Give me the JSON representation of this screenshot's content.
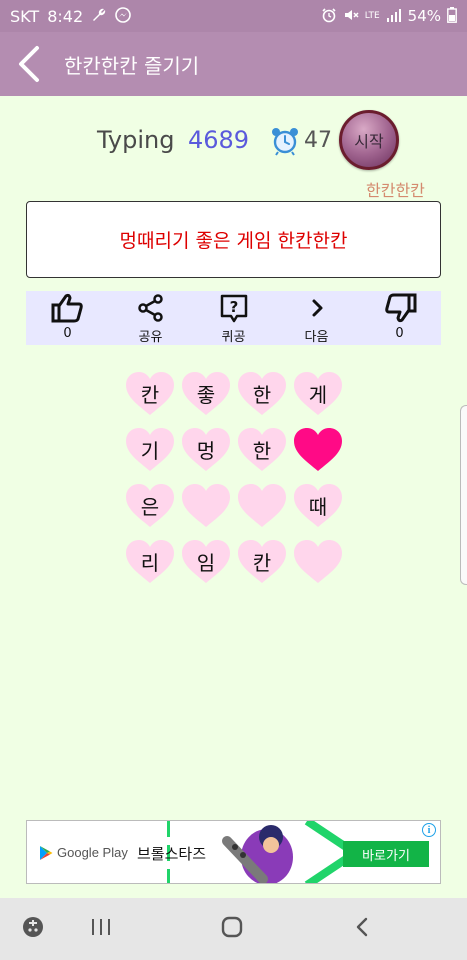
{
  "status_bar": {
    "carrier": "SKT",
    "time": "8:42",
    "network": "LTE",
    "battery": "54%"
  },
  "app_bar": {
    "title": "한칸한칸 즐기기"
  },
  "score": {
    "typing_label": "Typing",
    "typing_value": "4689",
    "timer_value": "47",
    "start_label": "시작",
    "game_name": "한칸한칸"
  },
  "message": "멍때리기 좋은 게임 한칸한칸",
  "actions": [
    {
      "icon": "thumbs-up-icon",
      "label": "0"
    },
    {
      "icon": "share-icon",
      "label": "공유"
    },
    {
      "icon": "quiz-icon",
      "label": "퀴공"
    },
    {
      "icon": "chevron-right-icon",
      "label": "다음"
    },
    {
      "icon": "thumbs-down-icon",
      "label": "0"
    }
  ],
  "hearts": [
    {
      "char": "칸",
      "selected": false
    },
    {
      "char": "좋",
      "selected": false
    },
    {
      "char": "한",
      "selected": false
    },
    {
      "char": "게",
      "selected": false
    },
    {
      "char": "기",
      "selected": false
    },
    {
      "char": "멍",
      "selected": false
    },
    {
      "char": "한",
      "selected": false
    },
    {
      "char": "",
      "selected": true
    },
    {
      "char": "은",
      "selected": false
    },
    {
      "char": "",
      "selected": false
    },
    {
      "char": "",
      "selected": false
    },
    {
      "char": "때",
      "selected": false
    },
    {
      "char": "리",
      "selected": false
    },
    {
      "char": "임",
      "selected": false
    },
    {
      "char": "칸",
      "selected": false
    },
    {
      "char": "",
      "selected": false
    }
  ],
  "ad": {
    "store_name": "Google Play",
    "title": "브롤스타즈",
    "cta": "바로가기",
    "info": "i"
  },
  "colors": {
    "background": "#f0ffe4",
    "app_bar": "#b48db1",
    "heart_normal": "#ffd6ec",
    "heart_selected": "#ff0a86",
    "message_text": "#dd0000",
    "typing_value": "#5a5adc"
  }
}
